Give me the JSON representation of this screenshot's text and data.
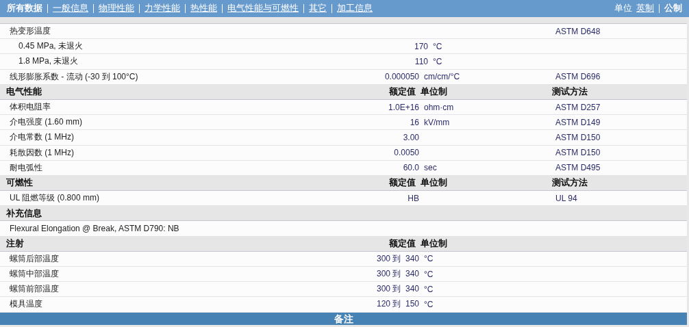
{
  "nav": {
    "tabs": [
      {
        "label": "所有数据",
        "selected": true
      },
      {
        "label": "一般信息",
        "selected": false
      },
      {
        "label": "物理性能",
        "selected": false
      },
      {
        "label": "力学性能",
        "selected": false
      },
      {
        "label": "热性能",
        "selected": false
      },
      {
        "label": "电气性能与可燃性",
        "selected": false
      },
      {
        "label": "其它",
        "selected": false
      },
      {
        "label": "加工信息",
        "selected": false
      }
    ],
    "units_label": "单位",
    "units": [
      {
        "label": "英制",
        "selected": false
      },
      {
        "label": "公制",
        "selected": true
      }
    ]
  },
  "sections": [
    {
      "rows": [
        {
          "name": "热变形温度",
          "method": "ASTM D648",
          "children": [
            {
              "name": "0.45 MPa, 未退火",
              "value": "170",
              "unit": "°C"
            },
            {
              "name": "1.8 MPa, 未退火",
              "value": "110",
              "unit": "°C"
            }
          ]
        },
        {
          "name": "线形膨胀系数 - 流动 (-30 到 100°C)",
          "value": "0.000050",
          "unit": "cm/cm/°C",
          "method": "ASTM D696"
        }
      ]
    },
    {
      "title": "电气性能",
      "columns": [
        "额定值",
        "单位制",
        "测试方法"
      ],
      "rows": [
        {
          "name": "体积电阻率",
          "value": "1.0E+16",
          "unit": "ohm·cm",
          "method": "ASTM D257"
        },
        {
          "name": "介电强度 (1.60 mm)",
          "value": "16",
          "unit": "kV/mm",
          "method": "ASTM D149"
        },
        {
          "name": "介电常数 (1 MHz)",
          "value": "3.00",
          "method": "ASTM D150"
        },
        {
          "name": "耗散因数 (1 MHz)",
          "value": "0.0050",
          "method": "ASTM D150"
        },
        {
          "name": "耐电弧性",
          "value": "60.0",
          "unit": "sec",
          "method": "ASTM D495"
        }
      ]
    },
    {
      "title": "可燃性",
      "columns": [
        "额定值",
        "单位制",
        "测试方法"
      ],
      "rows": [
        {
          "name": "UL 阻燃等级 (0.800 mm)",
          "value": "HB",
          "method": "UL 94"
        }
      ]
    },
    {
      "title": "补充信息",
      "rows": [
        {
          "name": "Flexural Elongation @ Break, ASTM D790: NB"
        }
      ]
    },
    {
      "title": "注射",
      "columns": [
        "额定值",
        "单位制"
      ],
      "rows": [
        {
          "name": "螺筒后部温度",
          "value": "300 到  340",
          "unit": "°C"
        },
        {
          "name": "螺筒中部温度",
          "value": "300 到  340",
          "unit": "°C"
        },
        {
          "name": "螺筒前部温度",
          "value": "300 到  340",
          "unit": "°C"
        },
        {
          "name": "模具温度",
          "value": "120 到  150",
          "unit": "°C"
        }
      ]
    }
  ],
  "footer": {
    "title": "备注"
  }
}
